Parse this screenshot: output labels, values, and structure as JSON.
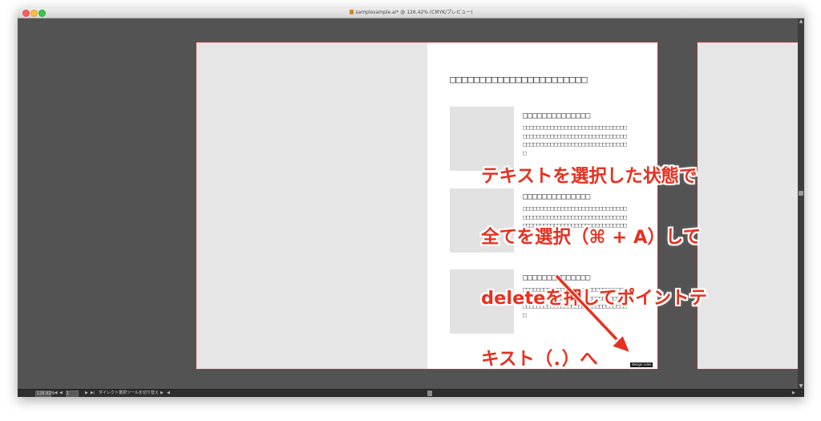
{
  "window": {
    "title": "samplesample.ai* @ 126.42% (CMYK/プレビュー)"
  },
  "artboard": {
    "heading": "□□□□□□□□□□□□□□□□□□□□□□□",
    "blocks": [
      {
        "title": "□□□□□□□□□□□□□□",
        "body": "□□□□□□□□□□□□□□□□□□□□□□□□□□□□□□□□□□□□□□□□□□□□□□□□□□□□□□□□□□□□□□□□□□□□□□□□□□□□□□□□□□□□□□□□□□□"
      },
      {
        "title": "□□□□□□□□□□□□□□",
        "body": "□□□□□□□□□□□□□□□□□□□□□□□□□□□□□□□□□□□□□□□□□□□□□□□□□□□□□□□□□□□□□□□□□□□□□□□□□□□□□□□□□□□□□□□□□□□"
      },
      {
        "title": "□□□□□□□□□□□□□□",
        "body": "□□□□□□□□□□□□□□□□□□□□□□□□□□□□□□□□□□□□□□□□□□□□□□□□□□□□□□□□□□□□□□□□□□□□□□□□□□□□□□□□□□□□□□□□□□□"
      }
    ],
    "label": "design rules"
  },
  "annotation": {
    "lines": [
      "テキストを選択した状態で",
      "全てを選択（⌘ + A）して",
      "deleteを押してポイントテ",
      "キスト（．）へ"
    ],
    "color": "#e8301f"
  },
  "statusbar": {
    "zoom": "126.42%",
    "page": "1",
    "tool_text": "ダイレクト選択ツールを切り替え"
  },
  "icons": {
    "first_page": "first-page-icon",
    "prev_page": "prev-page-icon",
    "next_page": "next-page-icon",
    "last_page": "last-page-icon",
    "scroll_up": "scroll-up-icon",
    "scroll_down": "scroll-down-icon"
  }
}
